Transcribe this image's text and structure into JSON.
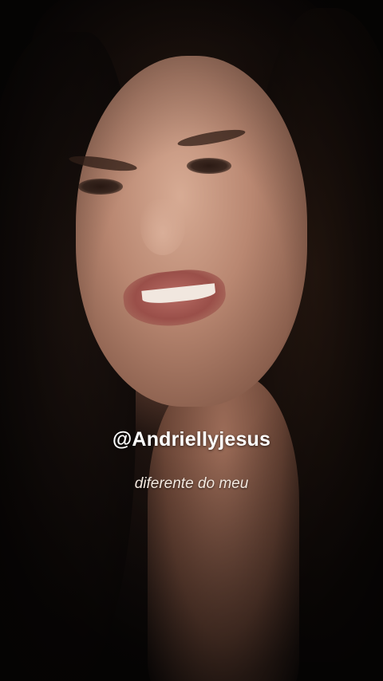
{
  "video": {
    "watermark": "@Andriellyjesus",
    "caption": "diferente do meu"
  }
}
